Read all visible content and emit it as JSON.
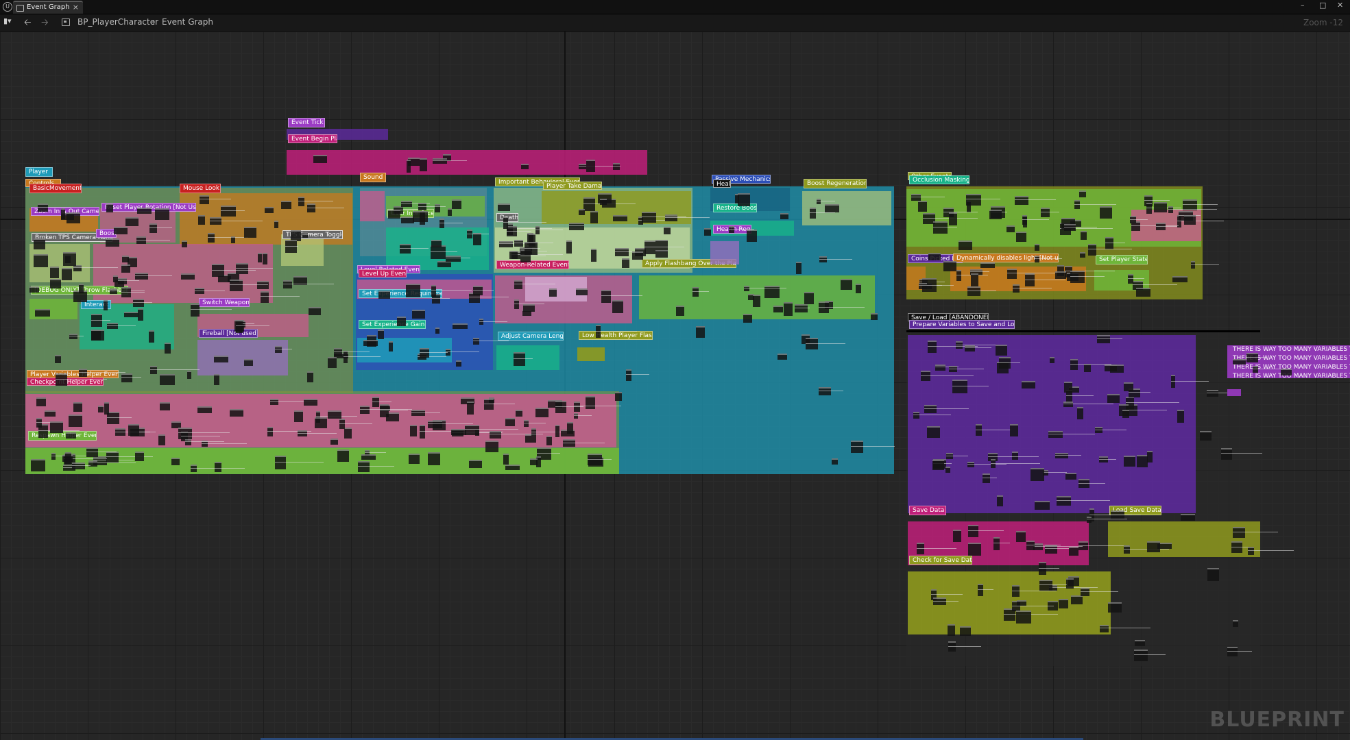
{
  "tab": {
    "title": "Event Graph",
    "close": "×"
  },
  "window": {
    "minimize": "–",
    "maximize": "□",
    "close": "✕"
  },
  "toolbar": {
    "menu_icon": "menu-icon",
    "back": "🡠",
    "forward": "🡢",
    "breadcrumb": [
      "BP_PlayerCharacter",
      "Event Graph"
    ],
    "separator": "›",
    "zoom": "Zoom -12"
  },
  "brand": "BLUEPRINT",
  "comments": {
    "player": "Player",
    "controls": "Controls",
    "basic_movement": "BasicMovement",
    "mouse_look": "Mouse Look",
    "zoom_camera": "Zoom In & Out Camera",
    "reset_rotation": "Reset Player Rotation [Not Used]",
    "broken_camera": "Broken TPS Camera Rotation",
    "boost": "Boost",
    "tps_toggle": "TPS Camera Toggle",
    "throw_flashbang": "[DEBUG ONLY] Throw Flashbang",
    "interact": "Interact",
    "switch_weapon": "Switch Weapon",
    "fireball": "Fireball [Not used]",
    "player_helper": "Player Variables Helper Events",
    "checkpoint_helper": "Checkpoint Helper Event",
    "respawn_helper": "Respawn Helper Event",
    "event_tick": "Event Tick",
    "event_begin": "Event Begin Play",
    "sound": "Sound",
    "user_interface": "User Interface",
    "level_events": "Level Related Events",
    "level_up": "Level Up Event",
    "set_exp_req": "Set Experience Requirement",
    "set_exp_gained": "Set Experience Gained",
    "important_events": "Important Behavioral Events",
    "take_damage": "Player Take Damage",
    "death": "Death",
    "weapon_events": "Weapon-Related Events",
    "camera_length": "Adjust Camera Length",
    "low_health": "Low Health Player Flash",
    "flashbang": "Apply Flashbang Over the Player",
    "passive": "Passive Mechanics",
    "heal": "Heal",
    "restore_boost": "Restore Boost",
    "health_regen": "Health Regen",
    "boost_regen": "Boost Regeneration",
    "other_events": "Other Events",
    "occlusion": "Occlusion Masking",
    "coins_picked": "Coins Picked Event",
    "disable_light": "Dynamically disables light [Not used]",
    "set_state": "Set Player State",
    "save_load": "Save / Load [ABANDONED]",
    "prepare_vars": "Prepare Variables to Save and Load",
    "save_data": "Save Data",
    "load_save": "Load Save Data",
    "check_save": "Check for Save Data",
    "too_many": [
      "THERE IS WAY TOO MANY VARIABLES TO S",
      "THERE IS WAY TOO MANY VARIABLES TO S",
      "THERE IS WAY TOO MANY VARIABLES TO S",
      "THERE IS WAY TOO MANY VARIABLES TO S"
    ]
  },
  "colors": {
    "cyan": "#1f9bb8",
    "green": "#6fb63a",
    "pink": "#c85a8c",
    "magenta": "#c0207a",
    "purple": "#5c2a9a",
    "orange": "#c8781e",
    "olive": "#8f9a1e",
    "teal": "#18b38a",
    "blue": "#2d4fb8",
    "violet": "#9b3bc4",
    "red": "#c82020",
    "lightgreen": "#a8c878"
  }
}
